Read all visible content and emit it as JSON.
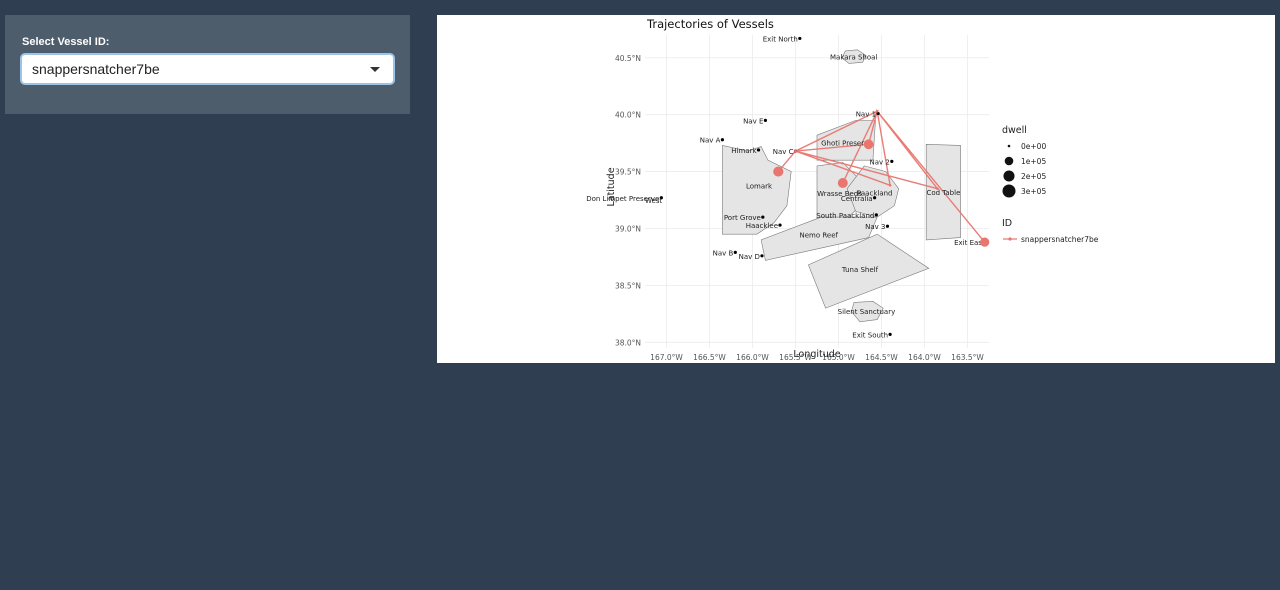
{
  "sidebar": {
    "label": "Select Vessel ID:",
    "selected_value": "snappersnatcher7be",
    "dropdown_icon": "caret-down-icon"
  },
  "colors": {
    "page_bg": "#2f3e51",
    "panel_bg": "#4e5d6c",
    "trajectory": "#e8766f",
    "region_fill": "#e5e5e5"
  },
  "chart_data": {
    "type": "scatter",
    "title": "Trajectories of Vessels",
    "xlabel": "Longitude",
    "ylabel": "Latitude",
    "xlim": [
      -167.25,
      -163.25
    ],
    "ylim": [
      37.95,
      40.7
    ],
    "x_ticks": [
      -167.0,
      -166.5,
      -166.0,
      -165.5,
      -165.0,
      -164.5,
      -164.0,
      -163.5
    ],
    "x_tick_labels": [
      "167.0°W",
      "166.5°W",
      "166.0°W",
      "165.5°W",
      "165.0°W",
      "164.5°W",
      "164.0°W",
      "163.5°W"
    ],
    "y_ticks": [
      38.0,
      38.5,
      39.0,
      39.5,
      40.0,
      40.5
    ],
    "y_tick_labels": [
      "38.0°N",
      "38.5°N",
      "39.0°N",
      "39.5°N",
      "40.0°N",
      "40.5°N"
    ],
    "grid": true,
    "regions": [
      {
        "name": "Makara Shoal",
        "polygon": [
          [
            -164.92,
            40.56
          ],
          [
            -164.78,
            40.57
          ],
          [
            -164.68,
            40.52
          ],
          [
            -164.72,
            40.46
          ],
          [
            -164.88,
            40.45
          ],
          [
            -164.96,
            40.5
          ]
        ]
      },
      {
        "name": "Lomark",
        "polygon": [
          [
            -166.35,
            39.73
          ],
          [
            -166.05,
            39.68
          ],
          [
            -165.9,
            39.72
          ],
          [
            -165.82,
            39.6
          ],
          [
            -165.55,
            39.5
          ],
          [
            -165.6,
            39.2
          ],
          [
            -165.75,
            39.05
          ],
          [
            -165.95,
            38.95
          ],
          [
            -166.35,
            38.95
          ]
        ]
      },
      {
        "name": "Ghoti Preserve",
        "polygon": [
          [
            -165.25,
            39.82
          ],
          [
            -164.8,
            39.95
          ],
          [
            -164.57,
            39.95
          ],
          [
            -164.6,
            39.6
          ],
          [
            -164.95,
            39.6
          ],
          [
            -165.25,
            39.6
          ]
        ]
      },
      {
        "name": "Wrasse Beds",
        "polygon": [
          [
            -165.25,
            39.55
          ],
          [
            -164.95,
            39.58
          ],
          [
            -164.78,
            39.45
          ],
          [
            -164.75,
            39.2
          ],
          [
            -164.95,
            39.05
          ],
          [
            -165.25,
            39.05
          ]
        ]
      },
      {
        "name": "Paackland",
        "polygon": [
          [
            -164.7,
            39.55
          ],
          [
            -164.45,
            39.5
          ],
          [
            -164.3,
            39.35
          ],
          [
            -164.35,
            39.2
          ],
          [
            -164.55,
            39.1
          ],
          [
            -164.8,
            39.15
          ],
          [
            -164.9,
            39.35
          ]
        ]
      },
      {
        "name": "Cod Table",
        "polygon": [
          [
            -163.98,
            39.74
          ],
          [
            -163.58,
            39.73
          ],
          [
            -163.58,
            38.92
          ],
          [
            -163.98,
            38.9
          ]
        ]
      },
      {
        "name": "Nemo Reef",
        "polygon": [
          [
            -165.9,
            38.9
          ],
          [
            -165.2,
            39.1
          ],
          [
            -164.55,
            39.1
          ],
          [
            -164.65,
            38.92
          ],
          [
            -165.85,
            38.72
          ]
        ]
      },
      {
        "name": "Tuna Shelf",
        "polygon": [
          [
            -165.35,
            38.68
          ],
          [
            -164.55,
            38.95
          ],
          [
            -163.95,
            38.65
          ],
          [
            -165.15,
            38.3
          ]
        ]
      },
      {
        "name": "Silent Sanctuary",
        "polygon": [
          [
            -164.82,
            38.35
          ],
          [
            -164.6,
            38.36
          ],
          [
            -164.48,
            38.3
          ],
          [
            -164.55,
            38.2
          ],
          [
            -164.75,
            38.18
          ],
          [
            -164.85,
            38.27
          ]
        ]
      }
    ],
    "places": [
      {
        "name": "Exit North",
        "x": -165.45,
        "y": 40.67
      },
      {
        "name": "Nav E",
        "x": -165.85,
        "y": 39.95
      },
      {
        "name": "Nav A",
        "x": -166.35,
        "y": 39.78
      },
      {
        "name": "Himark",
        "x": -165.93,
        "y": 39.69
      },
      {
        "name": "Nav C",
        "x": -165.5,
        "y": 39.68
      },
      {
        "name": "Nav 1",
        "x": -164.54,
        "y": 40.01
      },
      {
        "name": "Nav 2",
        "x": -164.38,
        "y": 39.59
      },
      {
        "name": "Centralia",
        "x": -164.58,
        "y": 39.27
      },
      {
        "name": "Don Limpet Preserve",
        "x": -167.06,
        "y": 39.27
      },
      {
        "name": "Port Grove",
        "x": -165.88,
        "y": 39.1
      },
      {
        "name": "Haacklee",
        "x": -165.68,
        "y": 39.03
      },
      {
        "name": "South Paackland",
        "x": -164.56,
        "y": 39.12
      },
      {
        "name": "Nav 3",
        "x": -164.43,
        "y": 39.02
      },
      {
        "name": "Nav B",
        "x": -166.2,
        "y": 38.79
      },
      {
        "name": "Nav D",
        "x": -165.89,
        "y": 38.76
      },
      {
        "name": "Exit South",
        "x": -164.4,
        "y": 38.07
      }
    ],
    "edge_labels": [
      {
        "text": "West",
        "x": -167.25,
        "y": 39.25
      },
      {
        "text": "Exit East",
        "x": -163.3,
        "y": 38.88
      }
    ],
    "dwell_legend": {
      "title": "dwell",
      "labels": [
        "0e+00",
        "1e+05",
        "2e+05",
        "3e+05"
      ],
      "values": [
        0,
        100000,
        200000,
        300000
      ]
    },
    "id_legend": {
      "title": "ID"
    },
    "series": [
      {
        "name": "snappersnatcher7be",
        "points": [
          {
            "x": -165.7,
            "y": 39.5,
            "dwell": 160000
          },
          {
            "x": -165.5,
            "y": 39.68,
            "dwell": 0
          },
          {
            "x": -164.55,
            "y": 40.03,
            "dwell": 0
          },
          {
            "x": -164.95,
            "y": 39.4,
            "dwell": 150000
          },
          {
            "x": -164.55,
            "y": 40.03,
            "dwell": 0
          },
          {
            "x": -165.5,
            "y": 39.68,
            "dwell": 0
          },
          {
            "x": -164.65,
            "y": 39.74,
            "dwell": 140000
          },
          {
            "x": -164.55,
            "y": 40.03,
            "dwell": 0
          },
          {
            "x": -163.85,
            "y": 39.35,
            "dwell": 0
          },
          {
            "x": -165.5,
            "y": 39.68,
            "dwell": 0
          },
          {
            "x": -164.4,
            "y": 39.38,
            "dwell": 0
          },
          {
            "x": -164.55,
            "y": 40.03,
            "dwell": 0
          },
          {
            "x": -163.3,
            "y": 38.88,
            "dwell": 120000
          }
        ]
      }
    ]
  }
}
